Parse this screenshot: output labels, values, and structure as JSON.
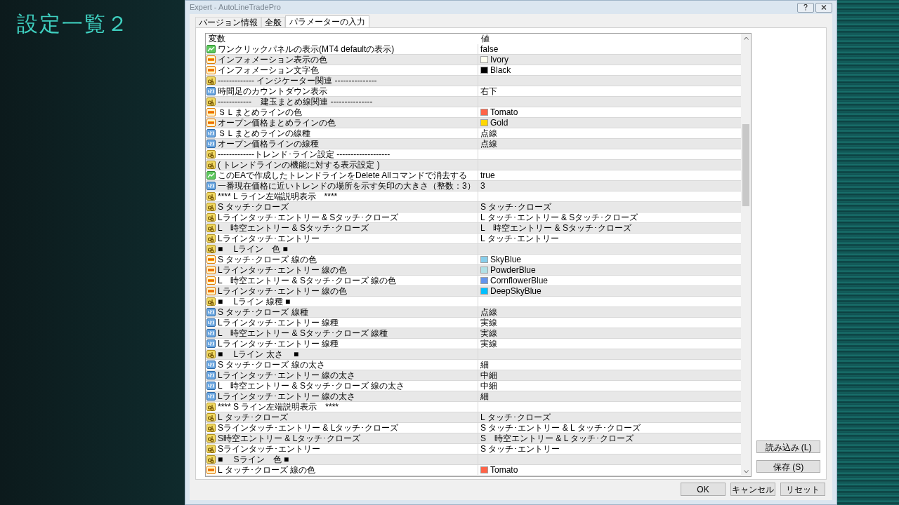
{
  "slide_title": "設定一覧２",
  "window": {
    "title": "Expert - AutoLineTradePro"
  },
  "tabs": [
    {
      "label": "バージョン情報",
      "selected": false
    },
    {
      "label": "全般",
      "selected": false
    },
    {
      "label": "パラメーターの入力",
      "selected": true
    }
  ],
  "table": {
    "columns": [
      "変数",
      "値"
    ],
    "rows": [
      {
        "kind": "bool",
        "name": "ワンクリックパネルの表示(MT4 defaultの表示)",
        "value": "false"
      },
      {
        "kind": "color",
        "name": "インフォメーション表示の色",
        "value": "Ivory",
        "color": "#fffff0"
      },
      {
        "kind": "color",
        "name": "インフォメーション文字色",
        "value": "Black",
        "color": "#000000"
      },
      {
        "kind": "string",
        "name": "------------- インジケーター関連 ---------------"
      },
      {
        "kind": "enum",
        "name": "時間足のカウントダウン表示",
        "value": "右下"
      },
      {
        "kind": "string",
        "name": "------------    建玉まとめ線関連 ---------------"
      },
      {
        "kind": "color",
        "name": "ＳＬまとめラインの色",
        "value": "Tomato",
        "color": "#ff6347"
      },
      {
        "kind": "color",
        "name": "オープン価格まとめラインの色",
        "value": "Gold",
        "color": "#ffd700"
      },
      {
        "kind": "enum",
        "name": "ＳＬまとめラインの線種",
        "value": "点線"
      },
      {
        "kind": "enum",
        "name": "オープン価格ラインの線種",
        "value": "点線"
      },
      {
        "kind": "string",
        "name": "-------------トレンド･ライン設定 -------------------"
      },
      {
        "kind": "string",
        "name": "( トレンドラインの機能に対する表示設定 )"
      },
      {
        "kind": "bool",
        "name": "このEAで作成したトレンドラインをDelete Allコマンドで消去する",
        "value": "true"
      },
      {
        "kind": "enum",
        "name": "一番現在価格に近いトレンドの場所を示す矢印の大きさ（整数：3）",
        "value": "3"
      },
      {
        "kind": "string",
        "name": "**** L ライン左端説明表示　****"
      },
      {
        "kind": "string",
        "name": "S タッチ･クローズ",
        "value": "S タッチ･クローズ"
      },
      {
        "kind": "string",
        "name": "Lラインタッチ･エントリー & Sタッチ･クローズ",
        "value": "L タッチ･エントリー & Sタッチ･クローズ"
      },
      {
        "kind": "string",
        "name": "L　時空エントリー & Sタッチ･クローズ",
        "value": "L　時空エントリー & Sタッチ･クローズ"
      },
      {
        "kind": "string",
        "name": "Lラインタッチ･エントリー",
        "value": "L タッチ･エントリー"
      },
      {
        "kind": "string",
        "name": "■　 Lライン　色 ■"
      },
      {
        "kind": "color",
        "name": "S タッチ･クローズ 線の色",
        "value": "SkyBlue",
        "color": "#87ceeb"
      },
      {
        "kind": "color",
        "name": "Lラインタッチ･エントリー 線の色",
        "value": "PowderBlue",
        "color": "#b0e0e6"
      },
      {
        "kind": "color",
        "name": "L　時空エントリー & Sタッチ･クローズ 線の色",
        "value": "CornflowerBlue",
        "color": "#6495ed"
      },
      {
        "kind": "color",
        "name": "Lラインタッチ･エントリー 線の色",
        "value": "DeepSkyBlue",
        "color": "#00bfff"
      },
      {
        "kind": "string",
        "name": "■　 Lライン 線種 ■"
      },
      {
        "kind": "enum",
        "name": "S タッチ･クローズ 線種",
        "value": "点線"
      },
      {
        "kind": "enum",
        "name": "Lラインタッチ･エントリー 線種",
        "value": "実線"
      },
      {
        "kind": "enum",
        "name": "L　時空エントリー & Sタッチ･クローズ 線種",
        "value": "実線"
      },
      {
        "kind": "enum",
        "name": "Lラインタッチ･エントリー 線種",
        "value": "実線"
      },
      {
        "kind": "string",
        "name": "■　 Lライン 太さ　 ■"
      },
      {
        "kind": "enum",
        "name": "S タッチ･クローズ 線の太さ",
        "value": "細"
      },
      {
        "kind": "enum",
        "name": "Lラインタッチ･エントリー 線の太さ",
        "value": "中細"
      },
      {
        "kind": "enum",
        "name": "L　時空エントリー & Sタッチ･クローズ 線の太さ",
        "value": "中細"
      },
      {
        "kind": "enum",
        "name": "Lラインタッチ･エントリー 線の太さ",
        "value": "細"
      },
      {
        "kind": "string",
        "name": "**** S ライン左端説明表示　****"
      },
      {
        "kind": "string",
        "name": "L タッチ･クローズ",
        "value": "L タッチ･クローズ"
      },
      {
        "kind": "string",
        "name": "Sラインタッチ･エントリー & Lタッチ･クローズ",
        "value": "S タッチ･エントリー & L タッチ･クローズ"
      },
      {
        "kind": "string",
        "name": "S時空エントリー & Lタッチ･クローズ",
        "value": "S　時空エントリー & L タッチ･クローズ"
      },
      {
        "kind": "string",
        "name": "Sラインタッチ･エントリー",
        "value": "S タッチ･エントリー"
      },
      {
        "kind": "string",
        "name": "■　 Sライン　色 ■"
      },
      {
        "kind": "color",
        "name": "L タッチ･クローズ 線の色",
        "value": "Tomato",
        "color": "#ff6347"
      }
    ]
  },
  "side_buttons": [
    "読み込み (L)",
    "保存 (S)"
  ],
  "buttons": [
    "OK",
    "キャンセル",
    "リセット"
  ]
}
